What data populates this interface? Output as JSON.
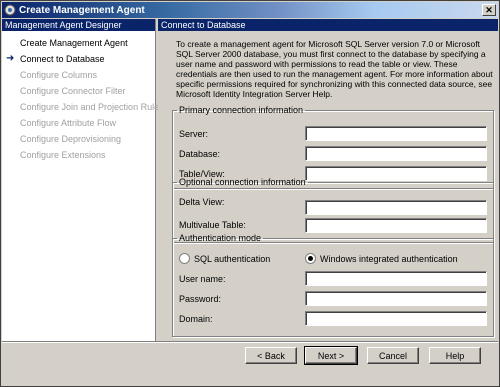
{
  "window": {
    "title": "Create Management Agent"
  },
  "sidebar": {
    "header": "Management Agent Designer",
    "items": [
      {
        "label": "Create Management Agent",
        "state": "enabled"
      },
      {
        "label": "Connect to Database",
        "state": "current"
      },
      {
        "label": "Configure Columns",
        "state": "disabled"
      },
      {
        "label": "Configure Connector Filter",
        "state": "disabled"
      },
      {
        "label": "Configure Join and Projection Rules",
        "state": "disabled"
      },
      {
        "label": "Configure Attribute Flow",
        "state": "disabled"
      },
      {
        "label": "Configure Deprovisioning",
        "state": "disabled"
      },
      {
        "label": "Configure Extensions",
        "state": "disabled"
      }
    ]
  },
  "main": {
    "header": "Connect to Database",
    "intro": "To create a management agent for Microsoft SQL Server version 7.0 or Microsoft SQL Server 2000 database, you must first connect to the database by specifying a user name and password with permissions to read the table or view. These credentials are then used to run the management agent. For more information about specific permissions required for synchronizing with this connected data source, see Microsoft Identity Integration Server Help.",
    "primary": {
      "legend": "Primary connection information",
      "server_label": "Server:",
      "server_value": "",
      "database_label": "Database:",
      "database_value": "",
      "table_label": "Table/View:",
      "table_value": ""
    },
    "optional": {
      "legend": "Optional connection information",
      "delta_label": "Delta View:",
      "delta_value": "",
      "multivalue_label": "Multivalue Table:",
      "multivalue_value": ""
    },
    "auth": {
      "legend": "Authentication mode",
      "sql_label": "SQL authentication",
      "windows_label": "Windows integrated authentication",
      "selected": "windows",
      "username_label": "User name:",
      "username_value": "",
      "password_label": "Password:",
      "password_value": "",
      "domain_label": "Domain:",
      "domain_value": ""
    }
  },
  "buttons": {
    "back": "< Back",
    "next": "Next >",
    "cancel": "Cancel",
    "help": "Help"
  },
  "colors": {
    "title_bar": "#0a246a",
    "panel_header": "#0a246a",
    "face": "#d4d0c8",
    "disabled_text": "#a0a0a0"
  }
}
